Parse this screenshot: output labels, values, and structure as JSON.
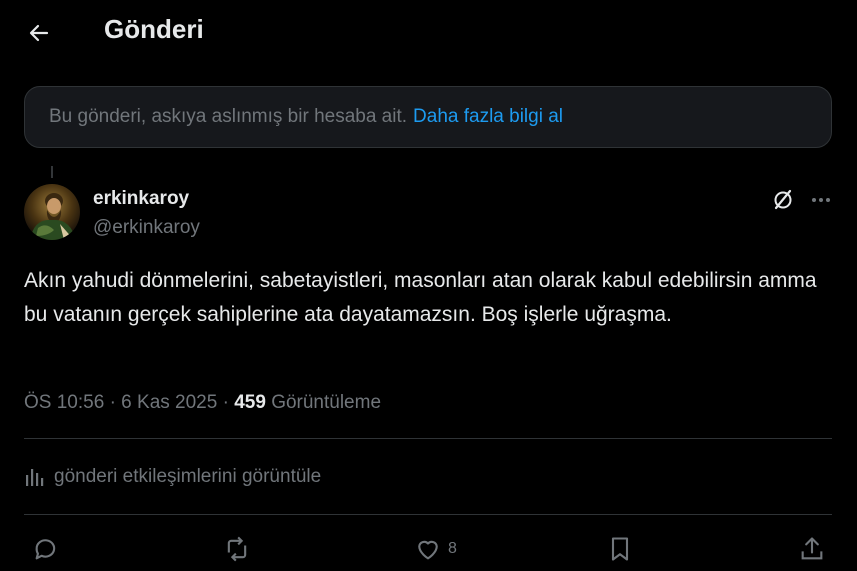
{
  "header": {
    "title": "Gönderi",
    "back_icon": "arrow-left-icon"
  },
  "notice": {
    "message": "Bu gönderi, askıya aslınmış bir hesaba ait.",
    "link": "Daha fazla bilgi al"
  },
  "post": {
    "display_name": "erkinkaroy",
    "handle": "@erkinkaroy",
    "text": "Akın yahudi dönmelerini, sabetayistleri, masonları atan olarak kabul edebilirsin amma bu vatanın gerçek sahiplerine ata dayatamazsın. Boş işlerle uğraşma.",
    "time": "ÖS 10:56",
    "separator": "·",
    "date": "6 Kas 2025",
    "views_count": "459",
    "views_label": "Görüntüleme"
  },
  "analytics": {
    "label": "gönderi etkileşimlerini görüntüle"
  },
  "actions": {
    "like_count": "8"
  },
  "colors": {
    "background": "#000000",
    "text": "#e7e9ea",
    "muted": "#71767b",
    "accent": "#1d9bf0",
    "border": "#2f3336",
    "notice_bg": "#16181c"
  }
}
